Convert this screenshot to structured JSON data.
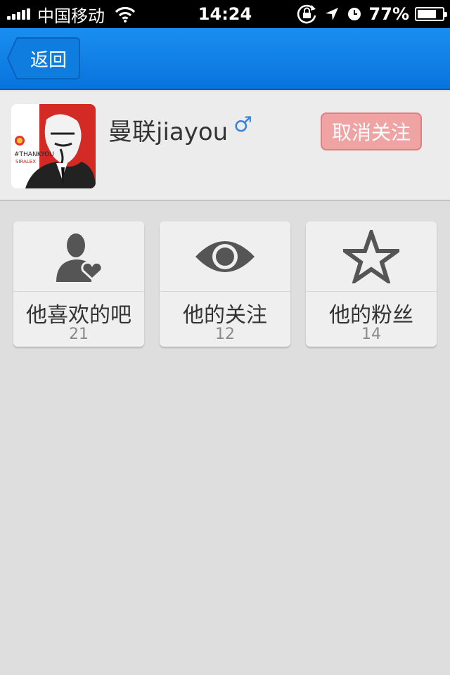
{
  "status_bar": {
    "carrier": "中国移动",
    "time": "14:24",
    "battery_percent": "77%",
    "battery_level": 0.77,
    "icons": [
      "signal-icon",
      "wifi-icon",
      "rotation-lock-icon",
      "location-icon",
      "alarm-icon",
      "battery-icon"
    ]
  },
  "nav": {
    "back_label": "返回",
    "accent": "#0b7de6"
  },
  "profile": {
    "username": "曼联jiayou",
    "gender_symbol": "♂",
    "unfollow_label": "取消关注",
    "avatar_texts": [
      "#THANKYOU",
      "SIRALEX"
    ]
  },
  "cards": [
    {
      "label": "他喜欢的吧",
      "count": "21",
      "icon": "user-heart-icon"
    },
    {
      "label": "他的关注",
      "count": "12",
      "icon": "eye-icon"
    },
    {
      "label": "他的粉丝",
      "count": "14",
      "icon": "star-icon"
    }
  ],
  "colors": {
    "unfollow_bg": "#f0a3a3",
    "page_bg": "#dedede"
  }
}
